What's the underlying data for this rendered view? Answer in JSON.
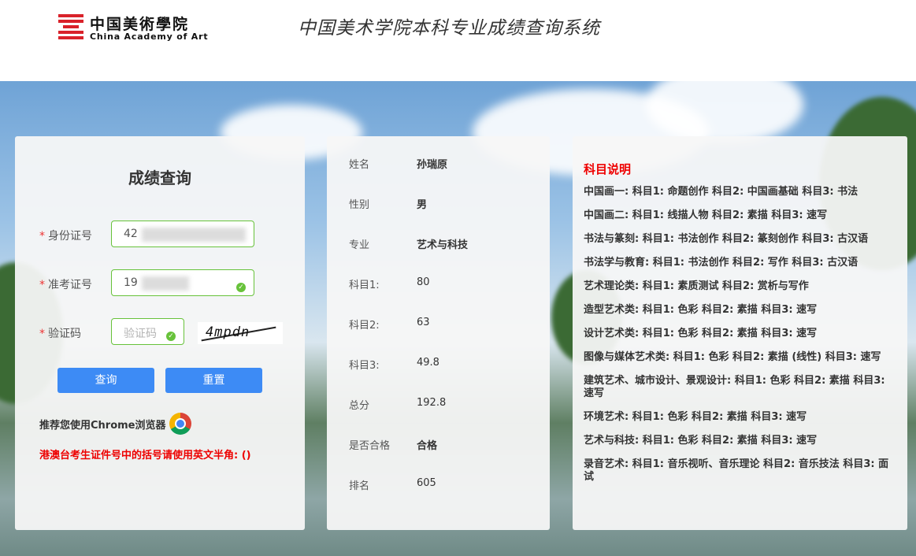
{
  "header": {
    "logo_cn": "中国美術學院",
    "logo_en": "China Academy of Art",
    "site_title": "中国美术学院本科专业成绩查询系统"
  },
  "form": {
    "title": "成绩查询",
    "id_label": "身份证号",
    "id_value": "42",
    "exam_label": "准考证号",
    "exam_value": "19",
    "captcha_label": "验证码",
    "captcha_placeholder": "验证码",
    "captcha_text": "4mpdn",
    "query_button": "查询",
    "reset_button": "重置",
    "chrome_note": "推荐您使用Chrome浏览器",
    "warning": "港澳台考生证件号中的括号请使用英文半角: ()"
  },
  "result": [
    {
      "label": "姓名",
      "value": "孙瑞原",
      "bold": true
    },
    {
      "label": "性别",
      "value": "男",
      "bold": true
    },
    {
      "label": "专业",
      "value": "艺术与科技",
      "bold": true
    },
    {
      "label": "科目1:",
      "value": "80",
      "bold": false
    },
    {
      "label": "科目2:",
      "value": "63",
      "bold": false
    },
    {
      "label": "科目3:",
      "value": "49.8",
      "bold": false
    },
    {
      "label": "总分",
      "value": "192.8",
      "bold": false
    },
    {
      "label": "是否合格",
      "value": "合格",
      "bold": true
    },
    {
      "label": "排名",
      "value": "605",
      "bold": false
    }
  ],
  "subjects": {
    "title": "科目说明",
    "items": [
      "中国画一: 科目1: 命题创作 科目2: 中国画基础 科目3: 书法",
      "中国画二: 科目1: 线描人物 科目2: 素描 科目3: 速写",
      "书法与篆刻: 科目1: 书法创作 科目2: 篆刻创作 科目3: 古汉语",
      "书法学与教育: 科目1: 书法创作 科目2: 写作 科目3: 古汉语",
      "艺术理论类: 科目1: 素质测试 科目2: 赏析与写作",
      "造型艺术类: 科目1: 色彩 科目2: 素描 科目3: 速写",
      "设计艺术类: 科目1: 色彩 科目2: 素描 科目3: 速写",
      "图像与媒体艺术类: 科目1: 色彩 科目2: 素描 (线性) 科目3: 速写",
      "建筑艺术、城市设计、景观设计: 科目1: 色彩 科目2: 素描 科目3: 速写",
      "环境艺术: 科目1: 色彩 科目2: 素描 科目3: 速写",
      "艺术与科技: 科目1: 色彩 科目2: 素描 科目3: 速写",
      "录音艺术: 科目1: 音乐视听、音乐理论 科目2: 音乐技法 科目3: 面试"
    ]
  }
}
